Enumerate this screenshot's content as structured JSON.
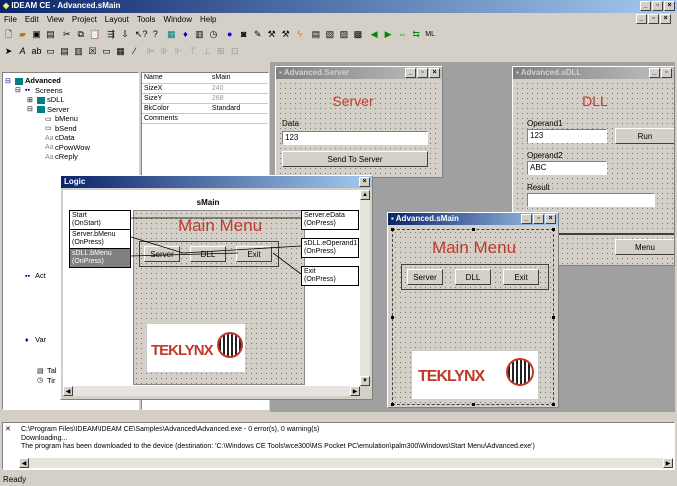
{
  "app": {
    "title": "IDEAM CE - Advanced.sMain"
  },
  "menu": [
    "File",
    "Edit",
    "View",
    "Project",
    "Layout",
    "Tools",
    "Window",
    "Help"
  ],
  "tree": {
    "items": [
      "Advanced",
      "Screens",
      "sDLL",
      "Server",
      "bMenu",
      "bSend",
      "cData",
      "cPowWow",
      "cReply",
      "Act",
      "Var",
      "Tal",
      "Tir"
    ]
  },
  "props": {
    "rows": [
      [
        "Name",
        "sMain"
      ],
      [
        "SizeX",
        "240"
      ],
      [
        "SizeY",
        "268"
      ],
      [
        "BkColor",
        "Standard"
      ],
      [
        "Comments",
        ""
      ]
    ]
  },
  "server_win": {
    "title": "Advanced.Server",
    "heading": "Server",
    "data_label": "Data",
    "data_value": "123",
    "send_btn": "Send To Server"
  },
  "dll_win": {
    "title": "Advanced.sDLL",
    "heading": "DLL",
    "op1_label": "Operand1",
    "op1_value": "123",
    "run_btn": "Run",
    "op2_label": "Operand2",
    "op2_value": "ABC",
    "result_label": "Result",
    "menu_btn": "Menu"
  },
  "logic": {
    "title": "Logic",
    "screen_name": "sMain",
    "heading": "Main Menu",
    "buttons": [
      "Server",
      "DLL",
      "Exit"
    ],
    "left_nodes": [
      [
        "Start",
        "(OnStart)"
      ],
      [
        "Server.bMenu",
        "(OnPress)"
      ],
      [
        "sDLL.bMenu",
        "(OnPress)"
      ]
    ],
    "right_nodes": [
      [
        "Server.eData",
        "(OnPress)"
      ],
      [
        "sDLL.eOperand1",
        "(OnPress)"
      ],
      [
        "Exit",
        "(OnPress)"
      ]
    ],
    "logo": "TEKLYNX"
  },
  "smain_win": {
    "title": "Advanced.sMain",
    "heading": "Main Menu",
    "buttons": [
      "Server",
      "DLL",
      "Exit"
    ],
    "logo": "TEKLYNX"
  },
  "output": {
    "lines": [
      "C:\\Program Files\\IDEAM\\IDEAM CE\\Samples\\Advanced\\Advanced.exe  -  0 error(s), 0 warning(s)",
      "Downloading...",
      "The program has been downloaded to the device (destination: 'C:\\Windows CE Tools\\wce300\\MS Pocket PC\\emulation\\palm300\\Windows\\Start Menu\\Advanced.exe')"
    ]
  },
  "status": "Ready"
}
